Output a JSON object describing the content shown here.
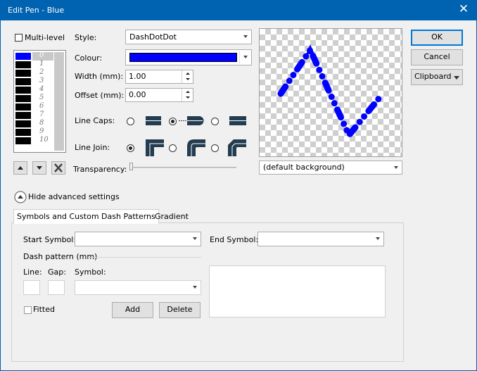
{
  "window": {
    "title": "Edit Pen - Blue",
    "close_glyph": "✕"
  },
  "multilevel": {
    "label": "Multi-level",
    "checked": false
  },
  "levels": {
    "active_number": "0",
    "numbers": [
      "1",
      "2",
      "3",
      "4",
      "5",
      "6",
      "7",
      "8",
      "9",
      "10"
    ],
    "active_color": "#0000ff",
    "row_color": "#000000"
  },
  "style": {
    "label": "Style:",
    "value": "DashDotDot"
  },
  "colour": {
    "label": "Colour:",
    "swatch": "#0000ff"
  },
  "width": {
    "label": "Width (mm):",
    "value": "1.00"
  },
  "offset": {
    "label": "Offset (mm):",
    "value": "0.00"
  },
  "line_caps": {
    "label": "Line Caps:",
    "selected_index": 1
  },
  "line_join": {
    "label": "Line Join:",
    "selected_index": 0
  },
  "transparency": {
    "label": "Transparency:",
    "level": 0
  },
  "background": {
    "value": "(default background)"
  },
  "buttons": {
    "ok": "OK",
    "cancel": "Cancel",
    "clipboard": "Clipboard"
  },
  "advanced": {
    "label": "Hide advanced settings"
  },
  "tabs": [
    {
      "label": "Symbols and Custom Dash Patterns",
      "active": true
    },
    {
      "label": "Gradient",
      "active": false
    }
  ],
  "symbols": {
    "start_label": "Start Symbol:",
    "end_label": "End Symbol:",
    "dash_pattern_label": "Dash pattern (mm)",
    "line_label": "Line:",
    "gap_label": "Gap:",
    "symbol_label": "Symbol:",
    "fitted_label": "Fitted",
    "add_label": "Add",
    "delete_label": "Delete"
  },
  "icons": {
    "close": "close-icon",
    "move_up": "arrow-up-icon",
    "move_down": "arrow-down-icon",
    "delete_level": "delete-x-icon",
    "collapse": "chevron-up-icon",
    "dropdown": "chevron-down-icon"
  },
  "colors": {
    "titlebar": "#0063b1",
    "pen": "#0000ff",
    "dialog_bg": "#f0f0f0"
  }
}
